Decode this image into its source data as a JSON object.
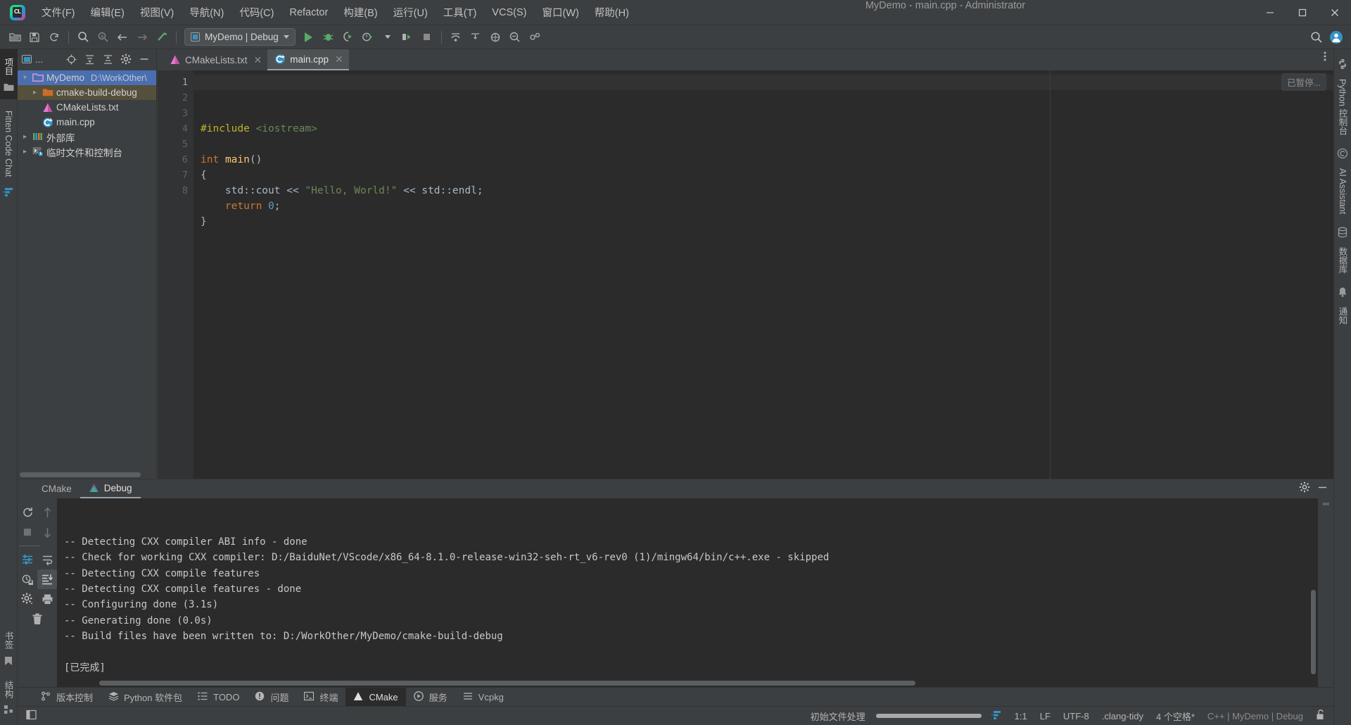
{
  "window": {
    "title": "MyDemo - main.cpp - Administrator",
    "app_icon": "clion-logo-icon",
    "minimize_label": "—",
    "maximize_label": "❐",
    "close_label": "✕"
  },
  "menu": [
    {
      "label": "文件(F)",
      "name": "menu-file"
    },
    {
      "label": "编辑(E)",
      "name": "menu-edit"
    },
    {
      "label": "视图(V)",
      "name": "menu-view"
    },
    {
      "label": "导航(N)",
      "name": "menu-navigate"
    },
    {
      "label": "代码(C)",
      "name": "menu-code"
    },
    {
      "label": "Refactor",
      "name": "menu-refactor"
    },
    {
      "label": "构建(B)",
      "name": "menu-build"
    },
    {
      "label": "运行(U)",
      "name": "menu-run"
    },
    {
      "label": "工具(T)",
      "name": "menu-tools"
    },
    {
      "label": "VCS(S)",
      "name": "menu-vcs"
    },
    {
      "label": "窗口(W)",
      "name": "menu-window"
    },
    {
      "label": "帮助(H)",
      "name": "menu-help"
    }
  ],
  "toolbar": {
    "run_config": "MyDemo | Debug",
    "icons": [
      "open-folder-icon",
      "save-icon",
      "sync-icon",
      "search-icon",
      "find-in-path-icon",
      "back-arrow-icon",
      "forward-arrow-icon",
      "build-hammer-icon"
    ],
    "run_icons": [
      "run-icon",
      "debug-icon",
      "run-with-coverage-icon",
      "profile-icon",
      "attach-process-icon",
      "stop-icon"
    ],
    "right_icons": [
      "search-everywhere-icon",
      "account-icon"
    ]
  },
  "project_panel": {
    "title": "项目",
    "header_label": "...",
    "header_icons": [
      "target-icon",
      "expand-all-icon",
      "collapse-all-icon",
      "gear-icon",
      "hide-icon"
    ],
    "tree": [
      {
        "label": "MyDemo",
        "path": "D:\\WorkOther\\",
        "icon": "project-folder-icon",
        "depth": 0,
        "expanded": true,
        "selected": true
      },
      {
        "label": "cmake-build-debug",
        "path": "",
        "icon": "build-folder-icon",
        "depth": 1,
        "expanded": false,
        "selected": false
      },
      {
        "label": "CMakeLists.txt",
        "path": "",
        "icon": "cmake-file-icon",
        "depth": 1,
        "expanded": null,
        "selected": false
      },
      {
        "label": "main.cpp",
        "path": "",
        "icon": "cpp-file-icon",
        "depth": 1,
        "expanded": null,
        "selected": false
      },
      {
        "label": "外部库",
        "path": "",
        "icon": "external-libraries-icon",
        "depth": 0,
        "expanded": false,
        "selected": false
      },
      {
        "label": "临时文件和控制台",
        "path": "",
        "icon": "scratches-icon",
        "depth": 0,
        "expanded": false,
        "selected": false
      }
    ]
  },
  "left_rail": {
    "top_label": "项目",
    "folder_icon": "folder-icon",
    "chat_label": "Fitten Code Chat",
    "chat_icon": "fitten-icon",
    "bottom_labels": [
      "书签",
      "结构"
    ],
    "bookmark_icon": "bookmark-icon",
    "structure_icon": "structure-icon"
  },
  "right_rail": {
    "items": [
      {
        "label": "Python 控制台",
        "icon": "python-icon"
      },
      {
        "label": "AI Assistant",
        "icon": "ai-assistant-icon"
      },
      {
        "label": "数据库",
        "icon": "database-icon"
      },
      {
        "label": "通知",
        "icon": "bell-icon"
      }
    ]
  },
  "editor": {
    "tabs": [
      {
        "label": "CMakeLists.txt",
        "icon": "cmake-file-icon",
        "active": false
      },
      {
        "label": "main.cpp",
        "icon": "cpp-file-icon",
        "active": true
      }
    ],
    "paused_badge": "已暂停...",
    "line_numbers": [
      "1",
      "2",
      "3",
      "4",
      "5",
      "6",
      "7",
      "8"
    ],
    "lines": [
      {
        "n": 1,
        "tokens": [
          {
            "t": "#include",
            "c": "k-inc"
          },
          {
            "t": " ",
            "c": "k-txt"
          },
          {
            "t": "<iostream>",
            "c": "k-hdr"
          }
        ]
      },
      {
        "n": 2,
        "tokens": []
      },
      {
        "n": 3,
        "tokens": [
          {
            "t": "int",
            "c": "k-kw"
          },
          {
            "t": " ",
            "c": "k-txt"
          },
          {
            "t": "main",
            "c": "k-fn"
          },
          {
            "t": "()",
            "c": "k-txt"
          }
        ]
      },
      {
        "n": 4,
        "tokens": [
          {
            "t": "{",
            "c": "k-txt"
          }
        ]
      },
      {
        "n": 5,
        "tokens": [
          {
            "t": "    std::cout << ",
            "c": "k-txt"
          },
          {
            "t": "\"Hello, World!\"",
            "c": "k-str"
          },
          {
            "t": " << std::endl;",
            "c": "k-txt"
          }
        ]
      },
      {
        "n": 6,
        "tokens": [
          {
            "t": "    ",
            "c": "k-txt"
          },
          {
            "t": "return",
            "c": "k-kw"
          },
          {
            "t": " ",
            "c": "k-txt"
          },
          {
            "t": "0",
            "c": "k-num"
          },
          {
            "t": ";",
            "c": "k-txt"
          }
        ]
      },
      {
        "n": 7,
        "tokens": [
          {
            "t": "}",
            "c": "k-txt"
          }
        ]
      },
      {
        "n": 8,
        "tokens": []
      }
    ],
    "more_icon": "more-options-icon"
  },
  "bottom_window": {
    "tabs": [
      {
        "label": "CMake",
        "icon": "",
        "active": false
      },
      {
        "label": "Debug",
        "icon": "cmake-profile-icon",
        "active": true
      }
    ],
    "tool_icons": [
      "gear-icon",
      "hide-icon"
    ],
    "rail_icons": [
      "rerun-icon",
      "scroll-up-icon",
      "stop-icon",
      "scroll-down-icon",
      "cmake-settings-icon",
      "soft-wrap-icon",
      "cmake-profiles-icon",
      "scroll-to-end-icon",
      "clear-history-icon",
      "print-icon",
      "settings-gear-icon",
      "delete-icon"
    ],
    "console_lines": [
      "-- Detecting CXX compiler ABI info - done",
      "-- Check for working CXX compiler: D:/BaiduNet/VScode/x86_64-8.1.0-release-win32-seh-rt_v6-rev0 (1)/mingw64/bin/c++.exe - skipped",
      "-- Detecting CXX compile features",
      "-- Detecting CXX compile features - done",
      "-- Configuring done (3.1s)",
      "-- Generating done (0.0s)",
      "-- Build files have been written to: D:/WorkOther/MyDemo/cmake-build-debug",
      "",
      "[已完成]"
    ]
  },
  "bottom_bar": {
    "items": [
      {
        "label": "版本控制",
        "icon": "vcs-icon",
        "active": false
      },
      {
        "label": "Python 软件包",
        "icon": "python-packages-icon",
        "active": false
      },
      {
        "label": "TODO",
        "icon": "todo-icon",
        "active": false
      },
      {
        "label": "问题",
        "icon": "problems-icon",
        "active": false
      },
      {
        "label": "终端",
        "icon": "terminal-icon",
        "active": false
      },
      {
        "label": "CMake",
        "icon": "cmake-icon",
        "active": true
      },
      {
        "label": "服务",
        "icon": "services-icon",
        "active": false
      },
      {
        "label": "Vcpkg",
        "icon": "vcpkg-icon",
        "active": false
      }
    ]
  },
  "status_bar": {
    "task_label": "初始文件处理",
    "fitten_icon": "fitten-icon",
    "caret_position": "1:1",
    "line_separator": "LF",
    "encoding": "UTF-8",
    "inspection": ".clang-tidy",
    "indent": "4 个空格*",
    "context": "C++ | MyDemo | Debug",
    "lock_icon": "unlocked-icon",
    "left_icon": "show-tool-window-icon"
  },
  "colors": {
    "accent_blue": "#3592c4",
    "selection_blue": "#4b6eaf",
    "panel_bg": "#3c3f41",
    "editor_bg": "#2b2b2b",
    "green_run": "#59a869",
    "cmake_pink": "#c653a8"
  }
}
